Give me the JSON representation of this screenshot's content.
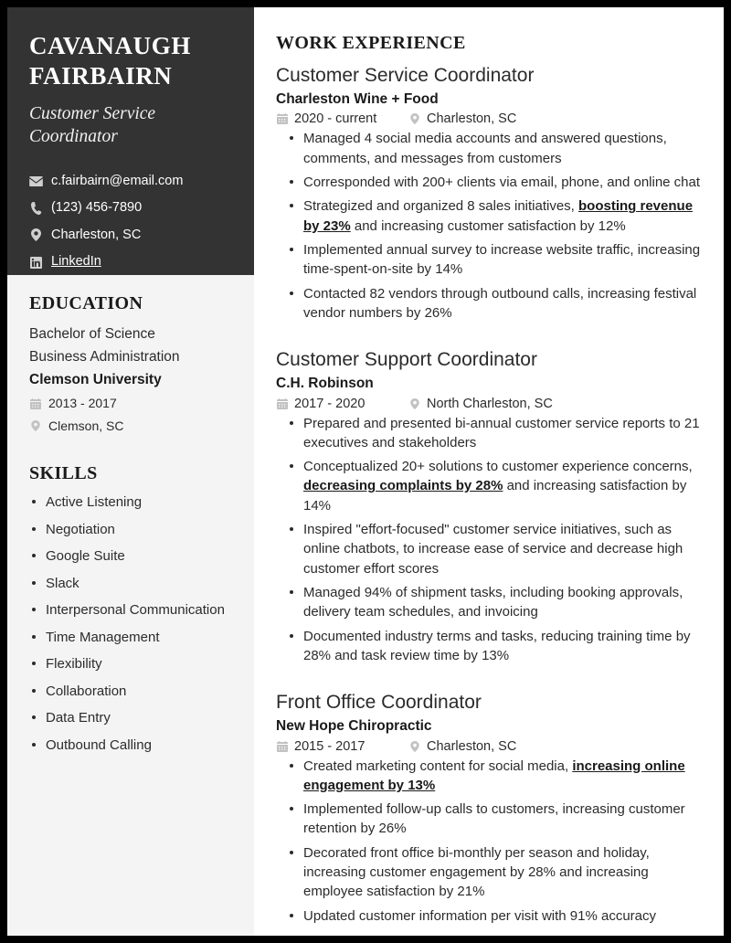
{
  "resume": {
    "name": "CAVANAUGH FAIRBAIRN",
    "role": "Customer Service Coordinator",
    "contact": [
      {
        "icon": "envelope-icon",
        "label": "c.fairbairn@email.com",
        "link": false
      },
      {
        "icon": "phone-icon",
        "label": "(123) 456-7890",
        "link": false
      },
      {
        "icon": "map-pin-icon",
        "label": "Charleston, SC",
        "link": false
      },
      {
        "icon": "linkedin-icon",
        "label": "LinkedIn",
        "link": true
      }
    ],
    "education": {
      "heading": "EDUCATION",
      "degree": "Bachelor of Science",
      "field": "Business Administration",
      "school": "Clemson University",
      "dates": "2013 - 2017",
      "location": "Clemson, SC"
    },
    "skills": {
      "heading": "SKILLS",
      "items": [
        "Active Listening",
        "Negotiation",
        "Google Suite",
        "Slack",
        "Interpersonal Communication",
        "Time Management",
        "Flexibility",
        "Collaboration",
        "Data Entry",
        "Outbound Calling"
      ]
    },
    "experience": {
      "heading": "WORK EXPERIENCE",
      "jobs": [
        {
          "title": "Customer Service Coordinator",
          "company": "Charleston Wine + Food",
          "dates": "2020 - current",
          "location": "Charleston, SC",
          "bullets": [
            [
              {
                "t": "Managed 4 social media accounts and answered questions, comments, and messages from customers"
              }
            ],
            [
              {
                "t": "Corresponded with 200+ clients via email, phone, and online chat"
              }
            ],
            [
              {
                "t": "Strategized and organized 8 sales initiatives, "
              },
              {
                "t": "boosting revenue by 23%",
                "emph": true
              },
              {
                "t": " and increasing customer satisfaction by 12%"
              }
            ],
            [
              {
                "t": "Implemented annual survey to increase website traffic, increasing time-spent-on-site by 14%"
              }
            ],
            [
              {
                "t": "Contacted 82 vendors through outbound calls, increasing festival vendor numbers by 26%"
              }
            ]
          ]
        },
        {
          "title": "Customer Support Coordinator",
          "company": "C.H. Robinson",
          "dates": "2017 - 2020",
          "location": "North Charleston, SC",
          "bullets": [
            [
              {
                "t": "Prepared and presented bi-annual customer service reports to 21 executives and stakeholders"
              }
            ],
            [
              {
                "t": "Conceptualized 20+ solutions to customer experience concerns, "
              },
              {
                "t": "decreasing complaints by 28%",
                "emph": true
              },
              {
                "t": " and increasing satisfaction by 14%"
              }
            ],
            [
              {
                "t": "Inspired \"effort-focused\" customer service initiatives, such as online chatbots, to increase ease of service and decrease high customer effort scores"
              }
            ],
            [
              {
                "t": "Managed 94% of shipment tasks, including booking approvals, delivery team schedules, and invoicing"
              }
            ],
            [
              {
                "t": "Documented industry terms and tasks, reducing training time by 28% and task review time by 13%"
              }
            ]
          ]
        },
        {
          "title": "Front Office Coordinator",
          "company": "New Hope Chiropractic",
          "dates": "2015 - 2017",
          "location": "Charleston, SC",
          "bullets": [
            [
              {
                "t": "Created marketing content for social media, "
              },
              {
                "t": "increasing online engagement by 13%",
                "emph": true
              }
            ],
            [
              {
                "t": "Implemented follow-up calls to customers, increasing customer retention by 26%"
              }
            ],
            [
              {
                "t": "Decorated front office bi-monthly per season and holiday, increasing customer engagement by 28% and increasing employee satisfaction by 21%"
              }
            ],
            [
              {
                "t": "Updated customer information per visit with 91% accuracy"
              }
            ]
          ]
        }
      ]
    }
  }
}
